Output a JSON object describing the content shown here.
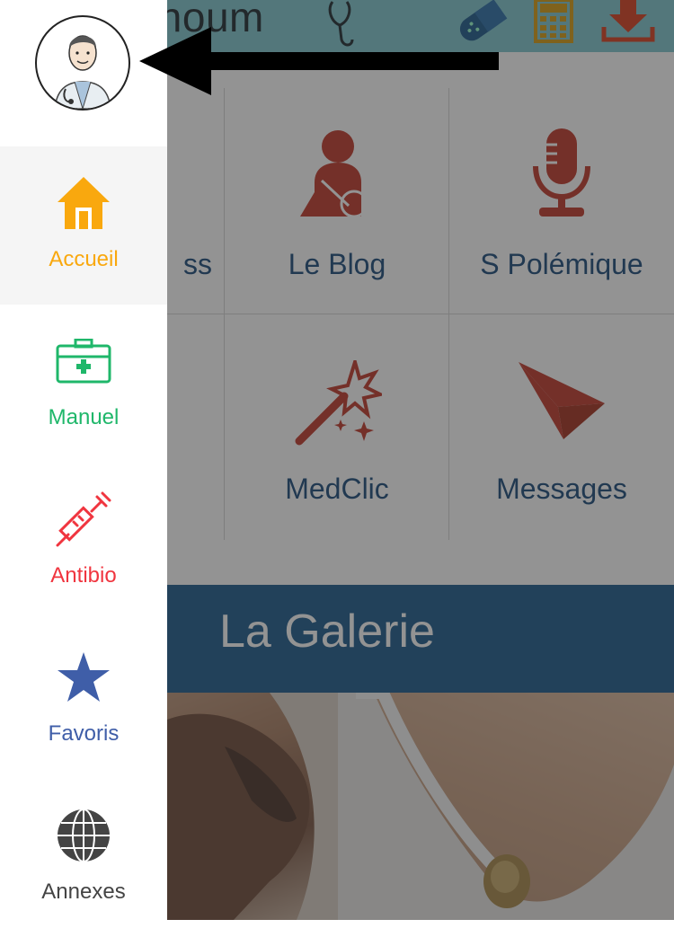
{
  "header": {
    "logo_text": "tchoum",
    "icons": [
      "pill-icon",
      "calculator-icon",
      "download-icon"
    ]
  },
  "grid": {
    "tiles": [
      {
        "label": "ss",
        "icon": "none"
      },
      {
        "label": "Le Blog",
        "icon": "injured-person-icon"
      },
      {
        "label": "S Polémique",
        "icon": "microphone-icon"
      },
      {
        "label": "",
        "icon": "none"
      },
      {
        "label": "MedClic",
        "icon": "magic-wand-icon"
      },
      {
        "label": "Messages",
        "icon": "paper-plane-icon"
      }
    ]
  },
  "gallery": {
    "title": "La Galerie"
  },
  "drawer": {
    "items": [
      {
        "label": "Accueil",
        "icon": "home-icon",
        "color": "#f9a80e"
      },
      {
        "label": "Manuel",
        "icon": "medical-kit-icon",
        "color": "#1fb76a"
      },
      {
        "label": "Antibio",
        "icon": "syringe-icon",
        "color": "#f0353f"
      },
      {
        "label": "Favoris",
        "icon": "star-icon",
        "color": "#3f5ea8"
      },
      {
        "label": "Annexes",
        "icon": "globe-icon",
        "color": "#444444"
      }
    ]
  },
  "colors": {
    "header_bg": "#7ec7cf",
    "tile_icon": "#c0392b",
    "tile_label": "#1b4a7a",
    "gallery_bg": "#1d5a8c"
  }
}
